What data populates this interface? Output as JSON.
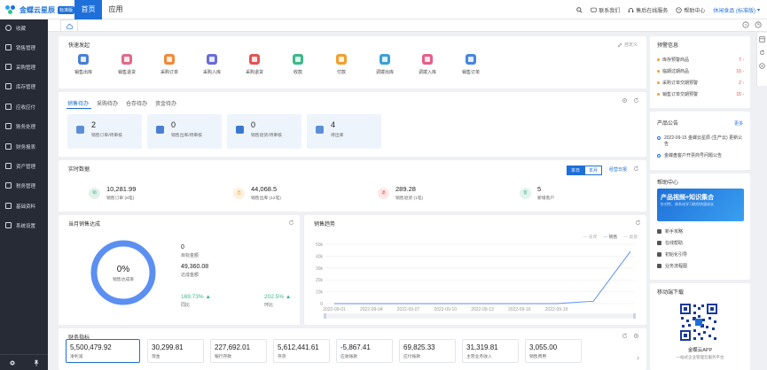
{
  "brand": {
    "name": "金蝶云星辰",
    "badge": "标准版"
  },
  "topnav": [
    {
      "label": "首页",
      "active": true
    },
    {
      "label": "应用",
      "active": false
    }
  ],
  "topright": {
    "contact": "联系我们",
    "service": "售后在线服务",
    "help": "帮助中心",
    "user": "休闲食品 (标准版)"
  },
  "sidebar": [
    {
      "label": "收藏",
      "icon": "star-icon"
    },
    {
      "label": "销售管理",
      "icon": "sales-icon"
    },
    {
      "label": "采购管理",
      "icon": "purchase-icon"
    },
    {
      "label": "库存管理",
      "icon": "inventory-icon"
    },
    {
      "label": "应收应付",
      "icon": "receivable-icon"
    },
    {
      "label": "账务处理",
      "icon": "accounting-icon"
    },
    {
      "label": "财务报表",
      "icon": "report-icon"
    },
    {
      "label": "资产管理",
      "icon": "asset-icon"
    },
    {
      "label": "税务管理",
      "icon": "tax-icon"
    },
    {
      "label": "基础资料",
      "icon": "basic-data-icon"
    },
    {
      "label": "系统设置",
      "icon": "settings-icon"
    }
  ],
  "quick": {
    "title": "快速发起",
    "custom": "自定义",
    "items": [
      {
        "label": "销售出库",
        "color": "#4a7fd4"
      },
      {
        "label": "销售退货",
        "color": "#e06a8a"
      },
      {
        "label": "采购订单",
        "color": "#f08a3c"
      },
      {
        "label": "采购入库",
        "color": "#6a6cd8"
      },
      {
        "label": "采购退货",
        "color": "#e25555"
      },
      {
        "label": "收款",
        "color": "#3bb88a"
      },
      {
        "label": "付款",
        "color": "#f0a030"
      },
      {
        "label": "调拨出库",
        "color": "#3aa0d8"
      },
      {
        "label": "调拨入库",
        "color": "#e36088"
      },
      {
        "label": "销售订单",
        "color": "#4a86e0"
      }
    ]
  },
  "pending": {
    "tabs": [
      "销售待办",
      "采购待办",
      "仓存待办",
      "资金待办"
    ],
    "boxes": [
      {
        "num": "2",
        "label": "销售订单/待审核"
      },
      {
        "num": "0",
        "label": "销售出库/待审核"
      },
      {
        "num": "0",
        "label": "销售退货/待审核"
      },
      {
        "num": "4",
        "label": "待出库"
      }
    ]
  },
  "realtime": {
    "title": "实时数据",
    "seg": [
      "本日",
      "本月"
    ],
    "link": "经营日报",
    "items": [
      {
        "icon": "销",
        "num": "10,281.99",
        "label": "销售订单 (6笔)",
        "bg": "#e3f1ea",
        "fg": "#3bb88a"
      },
      {
        "icon": "出",
        "num": "44,068.5",
        "label": "销售出库 (12笔)",
        "bg": "#fdf1e0",
        "fg": "#f0a030"
      },
      {
        "icon": "退",
        "num": "289.28",
        "label": "销售退货 (1笔)",
        "bg": "#fde8e8",
        "fg": "#e04848"
      },
      {
        "icon": "客",
        "num": "5",
        "label": "新增客户",
        "bg": "#e3f3ee",
        "fg": "#3bb88a"
      }
    ]
  },
  "monthly": {
    "title": "当月销售达成",
    "percent": "0%",
    "percent_label": "销售达成率",
    "target_num": "0",
    "target_label": "目标金额",
    "achieved_num": "49,360.08",
    "achieved_label": "达成金额",
    "yoy": "169.73% ▲",
    "yoy_label": "同比",
    "mom": "202.5% ▲",
    "mom_label": "环比"
  },
  "trend": {
    "title": "销售趋势",
    "legend": [
      "去年",
      "销售",
      "退货"
    ]
  },
  "chart_data": {
    "type": "line",
    "title": "销售趋势",
    "x": [
      "2022-09-01",
      "2022-09-04",
      "2022-09-07",
      "2022-09-10",
      "2022-09-13",
      "2022-09-16",
      "2022-09-19"
    ],
    "ylim": [
      0,
      50000
    ],
    "yticks": [
      "50k",
      "40k",
      "30k",
      "20k",
      "10k",
      "0"
    ],
    "series": [
      {
        "name": "销售",
        "values": [
          0,
          0,
          0,
          0,
          0,
          0,
          0,
          2000,
          44000
        ]
      }
    ],
    "legend_position": "top-right",
    "grid": true
  },
  "finance": {
    "title": "财务指标",
    "items": [
      {
        "num": "5,500,479.92",
        "label": "净利润"
      },
      {
        "num": "30,299.81",
        "label": "现金"
      },
      {
        "num": "227,692.01",
        "label": "银行存款"
      },
      {
        "num": "5,612,441.61",
        "label": "存货"
      },
      {
        "num": "-5,867.41",
        "label": "应收账款"
      },
      {
        "num": "69,825.33",
        "label": "应付账款"
      },
      {
        "num": "31,319.81",
        "label": "主营业务收入"
      },
      {
        "num": "3,055.00",
        "label": "销售费用"
      }
    ]
  },
  "warnings": {
    "title": "预警信息",
    "items": [
      {
        "label": "库存预警商品",
        "count": "7"
      },
      {
        "label": "临期过期商品",
        "count": "10"
      },
      {
        "label": "采购订单交期预警",
        "count": "2"
      },
      {
        "label": "销售订单交期预警",
        "count": "15"
      }
    ]
  },
  "announce": {
    "title": "产品公告",
    "more": "更多",
    "items": [
      {
        "text": "2022-09-15 金蝶云星辰 (生产云) 更新公告"
      },
      {
        "text": "金蝶盘客户开票商号问题公告"
      }
    ]
  },
  "help": {
    "title": "帮助中心",
    "banner_title": "产品视频+知识集合",
    "banner_sub": "针对性、体系化学习助你快速成长",
    "items": [
      "新手攻略",
      "在线帮助",
      "初始化引导",
      "业务流程图"
    ]
  },
  "mobile": {
    "title": "移动端下载",
    "app": "金蝶云APP",
    "sub": "一站式企业管理云服务平台"
  }
}
